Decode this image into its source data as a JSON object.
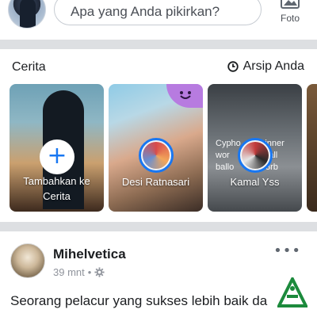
{
  "composer": {
    "placeholder": "Apa yang Anda pikirkan?",
    "photo_label": "Foto"
  },
  "stories": {
    "title": "Cerita",
    "archive_label": "Arsip Anda",
    "items": [
      {
        "label_line1": "Tambahkan ke",
        "label_line2": "Cerita"
      },
      {
        "label": "Desi Ratnasari"
      },
      {
        "overlay_line1": "Cypho",
        "overlay_line2": "inner",
        "overlay_line3": "wor",
        "overlay_line4": "erall",
        "overlay_line5": "ballo",
        "overlay_line6": "93rb",
        "label": "Kamal Yss"
      }
    ]
  },
  "post": {
    "author": "Mihelvetica",
    "time": "39 mnt",
    "separator": "•",
    "more": "•••",
    "text": "Seorang pelacur yang sukses lebih baik da"
  },
  "colors": {
    "accent": "#1877f2",
    "divider": "#dddfe2",
    "watermark": "#1c8a3c"
  }
}
